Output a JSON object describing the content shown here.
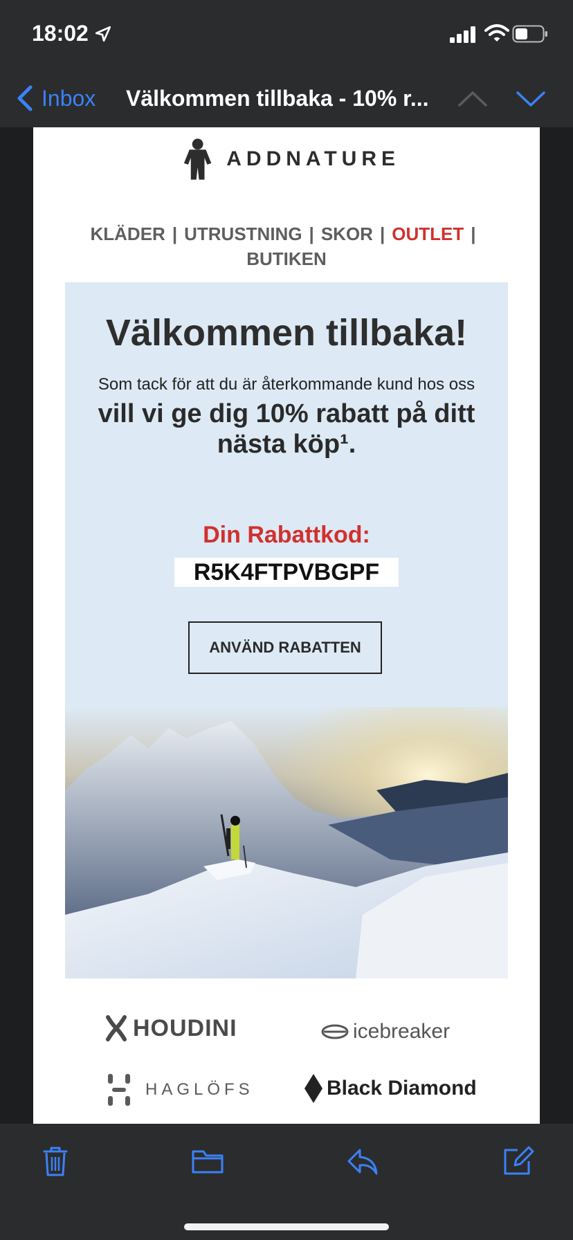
{
  "status": {
    "time": "18:02"
  },
  "nav": {
    "back_label": "Inbox",
    "title": "Välkommen tillbaka - 10% r..."
  },
  "email": {
    "brand": "ADDNATURE",
    "menu": [
      {
        "label": "KLÄDER"
      },
      {
        "label": "UTRUSTNING"
      },
      {
        "label": "SKOR"
      },
      {
        "label": "OUTLET"
      },
      {
        "label": "BUTIKEN"
      }
    ],
    "separator": "|",
    "hero": {
      "title": "Välkommen tillbaka!",
      "subtitle": "Som tack för att du är återkommande kund hos oss",
      "offer": "vill vi ge dig 10% rabatt på ditt nästa köp¹.",
      "code_label": "Din Rabattkod:",
      "code": "R5K4FTPVBGPF",
      "cta_label": "ANVÄND RABATTEN"
    },
    "brands": [
      {
        "name": "HOUDINI"
      },
      {
        "name": "icebreaker"
      },
      {
        "name": "HAGLÖFS"
      },
      {
        "name": "Black Diamond"
      }
    ]
  },
  "colors": {
    "accent": "#3b82f6",
    "outlet": "#d0312d",
    "hero_bg": "#dde9f4",
    "chrome_bg": "#2b2c2e"
  },
  "icons": [
    "location-icon",
    "signal-icon",
    "wifi-icon",
    "battery-icon",
    "chevron-left-icon",
    "chevron-up-icon",
    "chevron-down-icon",
    "trash-icon",
    "folder-icon",
    "reply-icon",
    "compose-icon"
  ]
}
